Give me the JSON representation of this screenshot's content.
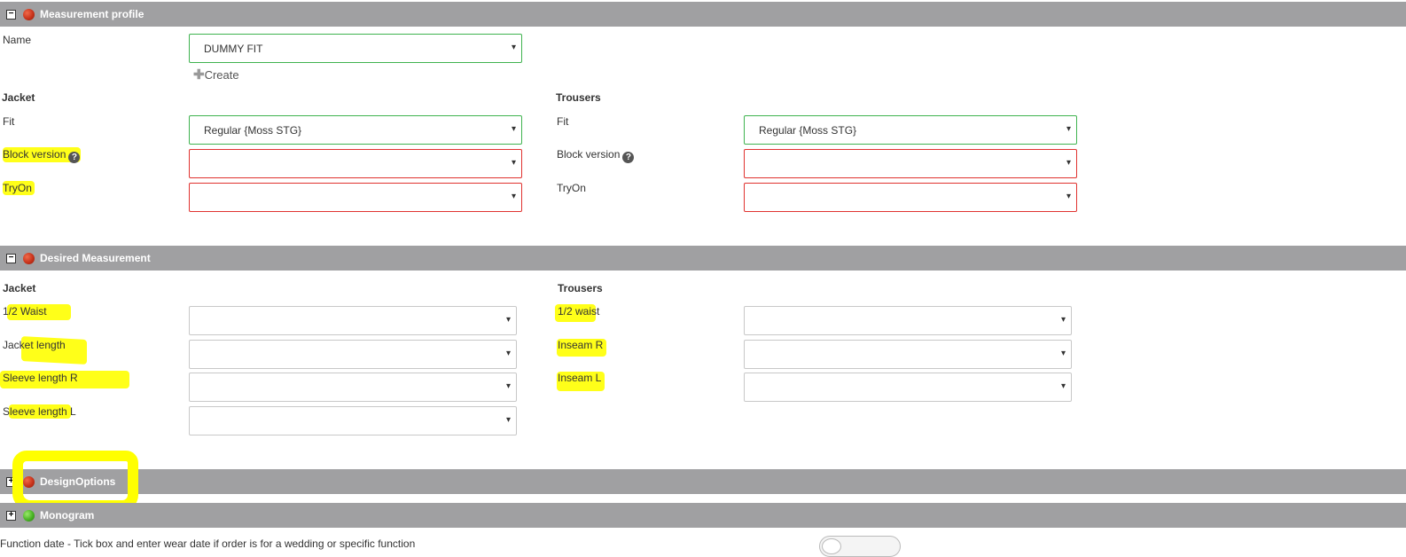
{
  "sections": {
    "measurement_profile": {
      "title": "Measurement profile",
      "toggle": "−",
      "status_color": "#c8331b"
    },
    "desired_measurement": {
      "title": "Desired Measurement",
      "toggle": "−",
      "status_color": "#c8331b"
    },
    "design_options": {
      "title": "DesignOptions",
      "toggle": "+",
      "status_color": "#c8331b"
    },
    "monogram": {
      "title": "Monogram",
      "toggle": "+",
      "status_color": "#48b324"
    }
  },
  "profile": {
    "name_label": "Name",
    "name_value": "DUMMY FIT",
    "create_label": "Create",
    "jacket": {
      "heading": "Jacket",
      "fit_label": "Fit",
      "fit_value": "Regular {Moss STG}",
      "block_label": "Block version",
      "block_value": "",
      "tryon_label": "TryOn",
      "tryon_value": ""
    },
    "trousers": {
      "heading": "Trousers",
      "fit_label": "Fit",
      "fit_value": "Regular {Moss STG}",
      "block_label": "Block version",
      "block_value": "",
      "tryon_label": "TryOn",
      "tryon_value": ""
    }
  },
  "desired": {
    "jacket": {
      "heading": "Jacket",
      "fields": [
        {
          "label": "1/2 Waist",
          "value": ""
        },
        {
          "label": "Jacket length",
          "value": ""
        },
        {
          "label": "Sleeve length R",
          "value": ""
        },
        {
          "label": "Sleeve length L",
          "value": ""
        }
      ]
    },
    "trousers": {
      "heading": "Trousers",
      "fields": [
        {
          "label": "1/2 waist",
          "value": ""
        },
        {
          "label": "Inseam R",
          "value": ""
        },
        {
          "label": "Inseam L",
          "value": ""
        }
      ]
    }
  },
  "footer": {
    "text": "Function date - Tick box and enter wear date if order is for a wedding or specific function"
  },
  "icons": {
    "caret": "▾",
    "help": "?",
    "plus": "✚"
  },
  "colors": {
    "highlight": "#ffff00",
    "valid_border": "#3fb34f",
    "invalid_border": "#e0322f",
    "section_bar": "#a0a0a2"
  }
}
